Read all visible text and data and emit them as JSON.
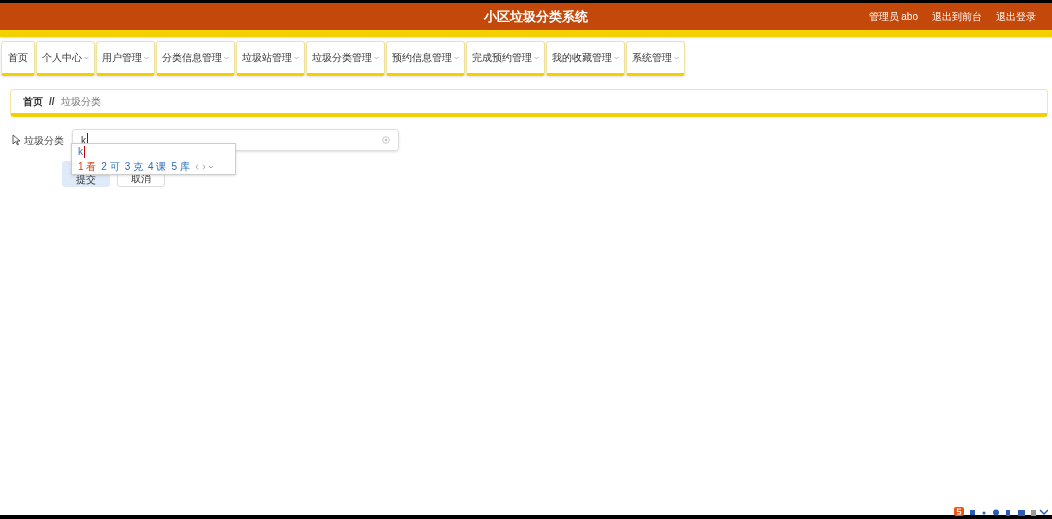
{
  "header": {
    "title": "小区垃圾分类系统",
    "links": [
      "管理员 abo",
      "退出到前台",
      "退出登录"
    ]
  },
  "nav": [
    {
      "label": "首页",
      "dropdown": false
    },
    {
      "label": "个人中心",
      "dropdown": true
    },
    {
      "label": "用户管理",
      "dropdown": true
    },
    {
      "label": "分类信息管理",
      "dropdown": true
    },
    {
      "label": "垃圾站管理",
      "dropdown": true
    },
    {
      "label": "垃圾分类管理",
      "dropdown": true
    },
    {
      "label": "预约信息管理",
      "dropdown": true
    },
    {
      "label": "完成预约管理",
      "dropdown": true
    },
    {
      "label": "我的收藏管理",
      "dropdown": true
    },
    {
      "label": "系统管理",
      "dropdown": true
    }
  ],
  "breadcrumb": {
    "items": [
      "首页",
      "垃圾分类"
    ],
    "separator": "//"
  },
  "form": {
    "label": "垃圾分类",
    "value": "k",
    "buttons": [
      {
        "label": "提交",
        "kind": "primary"
      },
      {
        "label": "取消",
        "kind": "default"
      }
    ]
  },
  "ime": {
    "composition": "k",
    "candidates": [
      {
        "index": "1",
        "text": "看",
        "selected": true
      },
      {
        "index": "2",
        "text": "可",
        "selected": false
      },
      {
        "index": "3",
        "text": "克",
        "selected": false
      },
      {
        "index": "4",
        "text": "课",
        "selected": false
      },
      {
        "index": "5",
        "text": "库",
        "selected": false
      }
    ]
  }
}
